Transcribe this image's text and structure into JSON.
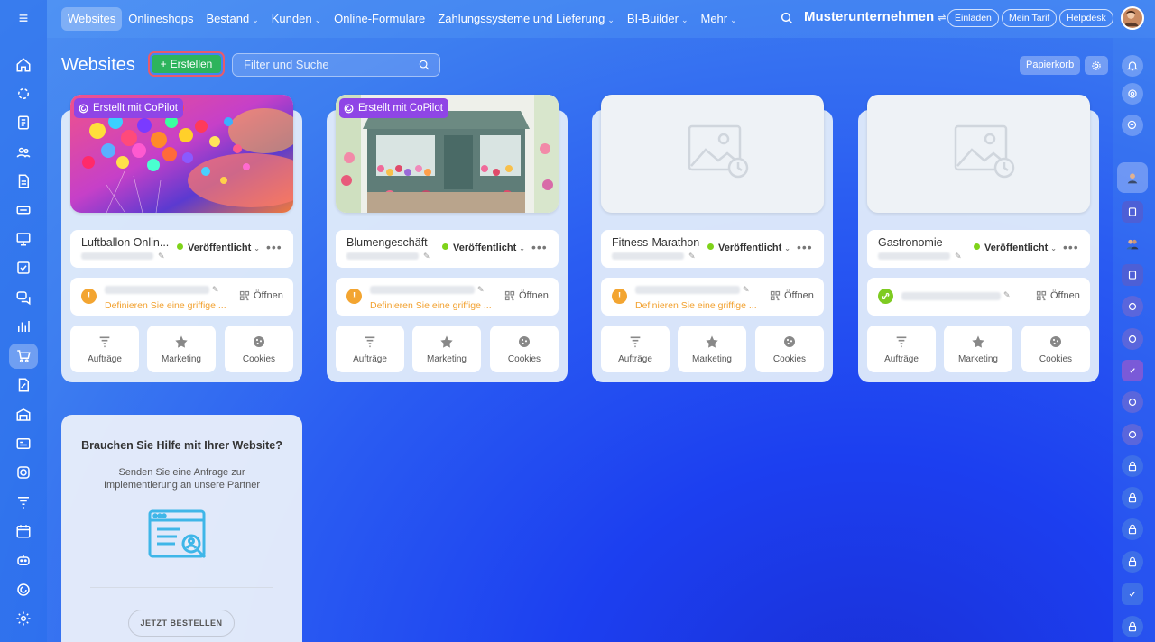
{
  "topbar": {
    "tabs": [
      {
        "label": "Websites",
        "active": true,
        "caret": false
      },
      {
        "label": "Onlineshops",
        "caret": false
      },
      {
        "label": "Bestand",
        "caret": true
      },
      {
        "label": "Kunden",
        "caret": true
      },
      {
        "label": "Online-Formulare",
        "caret": false
      },
      {
        "label": "Zahlungssysteme und Lieferung",
        "caret": true
      },
      {
        "label": "BI-Builder",
        "caret": true
      },
      {
        "label": "Mehr",
        "caret": true
      }
    ],
    "company": "Musterunternehmen",
    "invite": "Einladen",
    "plan": "Mein Tarif",
    "helpdesk": "Helpdesk"
  },
  "page": {
    "title": "Websites",
    "create": "Erstellen",
    "filter_placeholder": "Filter und Suche",
    "trash": "Papierkorb"
  },
  "sites": [
    {
      "name": "Luftballon Onlin...",
      "copilot": "Erstellt mit CoPilot",
      "image": "balloons",
      "status": "Veröffentlicht",
      "domain_state": "warning",
      "hint": "Definieren Sie eine griffige ...",
      "open": "Öffnen"
    },
    {
      "name": "Blumengeschäft",
      "copilot": "Erstellt mit CoPilot",
      "image": "flower-shop",
      "status": "Veröffentlicht",
      "domain_state": "warning",
      "hint": "Definieren Sie eine griffige ...",
      "open": "Öffnen"
    },
    {
      "name": "Fitness-Marathon",
      "copilot": "",
      "image": "placeholder",
      "status": "Veröffentlicht",
      "domain_state": "warning",
      "hint": "Definieren Sie eine griffige ...",
      "open": "Öffnen"
    },
    {
      "name": "Gastronomie",
      "copilot": "",
      "image": "placeholder",
      "status": "Veröffentlicht",
      "domain_state": "ok",
      "hint": "",
      "open": "Öffnen"
    }
  ],
  "tiles": {
    "orders": "Aufträge",
    "marketing": "Marketing",
    "cookies": "Cookies"
  },
  "help": {
    "title": "Brauchen Sie Hilfe mit Ihrer Website?",
    "text": "Senden Sie eine Anfrage zur Implementierung an unsere Partner",
    "button": "JETZT BESTELLEN"
  },
  "colors": {
    "accent_green": "#2db45c",
    "warning": "#f2a12f",
    "copilot": "#8f45e6",
    "status_dot": "#7fd31a"
  }
}
